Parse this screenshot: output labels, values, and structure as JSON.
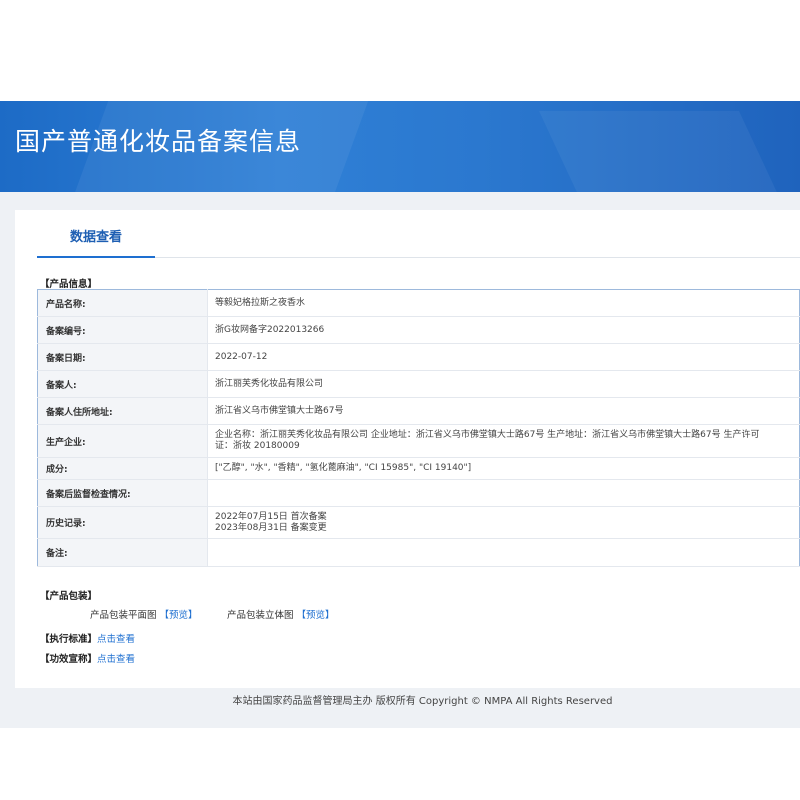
{
  "banner": {
    "title": "国产普通化妆品备案信息"
  },
  "tabs": {
    "active": "数据查看"
  },
  "product_info": {
    "section_label": "【产品信息】",
    "rows": [
      {
        "key": "产品名称:",
        "value": "等毅妃格拉斯之夜香水"
      },
      {
        "key": "备案编号:",
        "value": "浙G妆网备字2022013266"
      },
      {
        "key": "备案日期:",
        "value": "2022-07-12"
      },
      {
        "key": "备案人:",
        "value": "浙江丽芙秀化妆品有限公司"
      },
      {
        "key": "备案人住所地址:",
        "value": "浙江省义乌市佛堂镇大士路67号"
      },
      {
        "key": "生产企业:",
        "value": "企业名称：浙江丽芙秀化妆品有限公司 企业地址：浙江省义乌市佛堂镇大士路67号 生产地址：浙江省义乌市佛堂镇大士路67号 生产许可证：浙妆 20180009"
      },
      {
        "key": "成分:",
        "value": "[\"乙醇\", \"水\", \"香精\", \"氢化蓖麻油\", \"CI 15985\", \"CI 19140\"]"
      },
      {
        "key": "备案后监督检查情况:",
        "value": ""
      },
      {
        "key": "历史记录:",
        "value_lines": [
          "2022年07月15日 首次备案",
          "2023年08月31日 备案变更"
        ]
      },
      {
        "key": "备注:",
        "value": ""
      }
    ]
  },
  "packaging": {
    "section_label": "【产品包装】",
    "flat_label": "产品包装平面图",
    "flat_link": "【预览】",
    "solid_label": "产品包装立体图",
    "solid_link": "【预览】"
  },
  "standard": {
    "label": "【执行标准】",
    "link": "点击查看"
  },
  "efficacy": {
    "label": "【功效宣称】",
    "link": "点击查看"
  },
  "footer": {
    "text": "本站由国家药品监督管理局主办 版权所有 Copyright © NMPA All Rights Reserved"
  }
}
